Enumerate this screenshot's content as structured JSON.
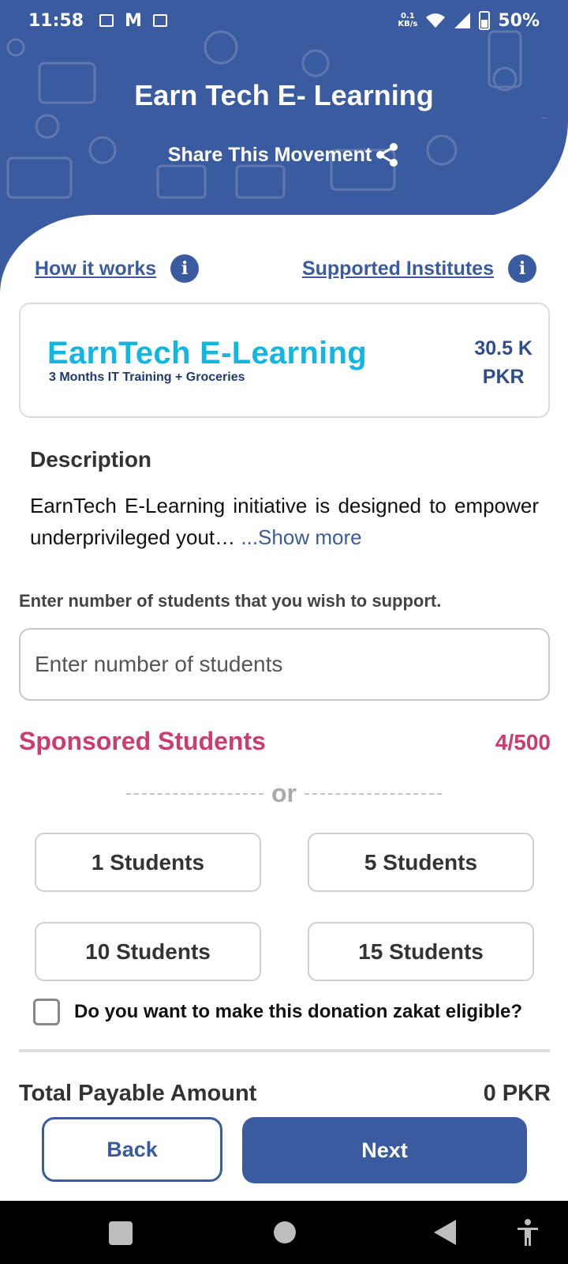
{
  "status_bar": {
    "time": "11:58",
    "net_speed_value": "0.1",
    "net_speed_unit": "KB/s",
    "battery": "50%"
  },
  "header": {
    "title": "Earn Tech E- Learning",
    "share_label": "Share This Movement"
  },
  "links": {
    "how_it_works": "How it works",
    "supported_institutes": "Supported Institutes"
  },
  "program_card": {
    "logo_title": "EarnTech E-Learning",
    "logo_subtitle": "3 Months IT Training + Groceries",
    "price_amount": "30.5 K",
    "price_currency": "PKR"
  },
  "description": {
    "title": "Description",
    "text": "EarnTech E-Learning initiative is designed to empower underprivileged yout… ",
    "show_more": "...Show more"
  },
  "students_input": {
    "label": "Enter number of students that you wish to support.",
    "placeholder": "Enter number of students",
    "value": ""
  },
  "sponsored": {
    "label": "Sponsored Students",
    "count": "4/500"
  },
  "or_separator": "or",
  "options": [
    {
      "label": "1 Students"
    },
    {
      "label": "5 Students"
    },
    {
      "label": "10 Students"
    },
    {
      "label": "15 Students"
    }
  ],
  "zakat": {
    "label": "Do you want to make this donation zakat eligible?",
    "checked": false
  },
  "total": {
    "label": "Total Payable Amount",
    "value": "0 PKR"
  },
  "buttons": {
    "back": "Back",
    "next": "Next"
  },
  "colors": {
    "primary": "#3b5ba0",
    "accent_pink": "#cc3d6e",
    "logo_cyan": "#12b6e0"
  }
}
